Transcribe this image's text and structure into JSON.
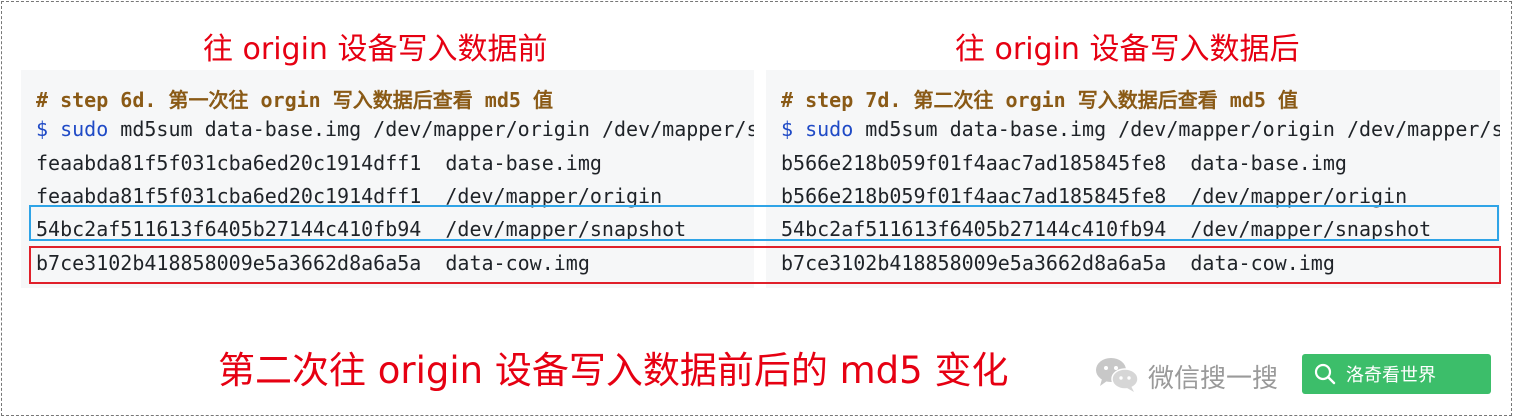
{
  "left_heading": "往 origin 设备写入数据前",
  "right_heading": "往 origin 设备写入数据后",
  "left_panel": {
    "comment": "# step 6d. 第一次往 orgin 写入数据后查看 md5 值",
    "prompt": "$",
    "sudo": "sudo",
    "command": " md5sum data-base.img /dev/mapper/origin /dev/mapper/s",
    "rows": [
      "feaabda81f5f031cba6ed20c1914dff1  data-base.img",
      "feaabda81f5f031cba6ed20c1914dff1  /dev/mapper/origin",
      "54bc2af511613f6405b27144c410fb94  /dev/mapper/snapshot",
      "b7ce3102b418858009e5a3662d8a6a5a  data-cow.img"
    ]
  },
  "right_panel": {
    "comment": "# step 7d. 第二次往 orgin 写入数据后查看 md5 值",
    "prompt": "$",
    "sudo": "sudo",
    "command": " md5sum data-base.img /dev/mapper/origin /dev/mapper/s",
    "rows": [
      "b566e218b059f01f4aac7ad185845fe8  data-base.img",
      "b566e218b059f01f4aac7ad185845fe8  /dev/mapper/origin",
      "54bc2af511613f6405b27144c410fb94  /dev/mapper/snapshot",
      "b7ce3102b418858009e5a3662d8a6a5a  data-cow.img"
    ]
  },
  "caption": "第二次往 origin 设备写入数据前后的 md5 变化",
  "wechat": {
    "label": "微信搜一搜",
    "search_text": "洛奇看世界"
  },
  "colors": {
    "heading": "#e60012",
    "highlight_blue": "#2fa4e7",
    "highlight_red": "#e0202a",
    "search_green": "#3cbe6a",
    "comment": "#8a5a16",
    "prompt": "#1f4ac6"
  },
  "icons": [
    "wechat-logo-icon",
    "search-icon"
  ]
}
